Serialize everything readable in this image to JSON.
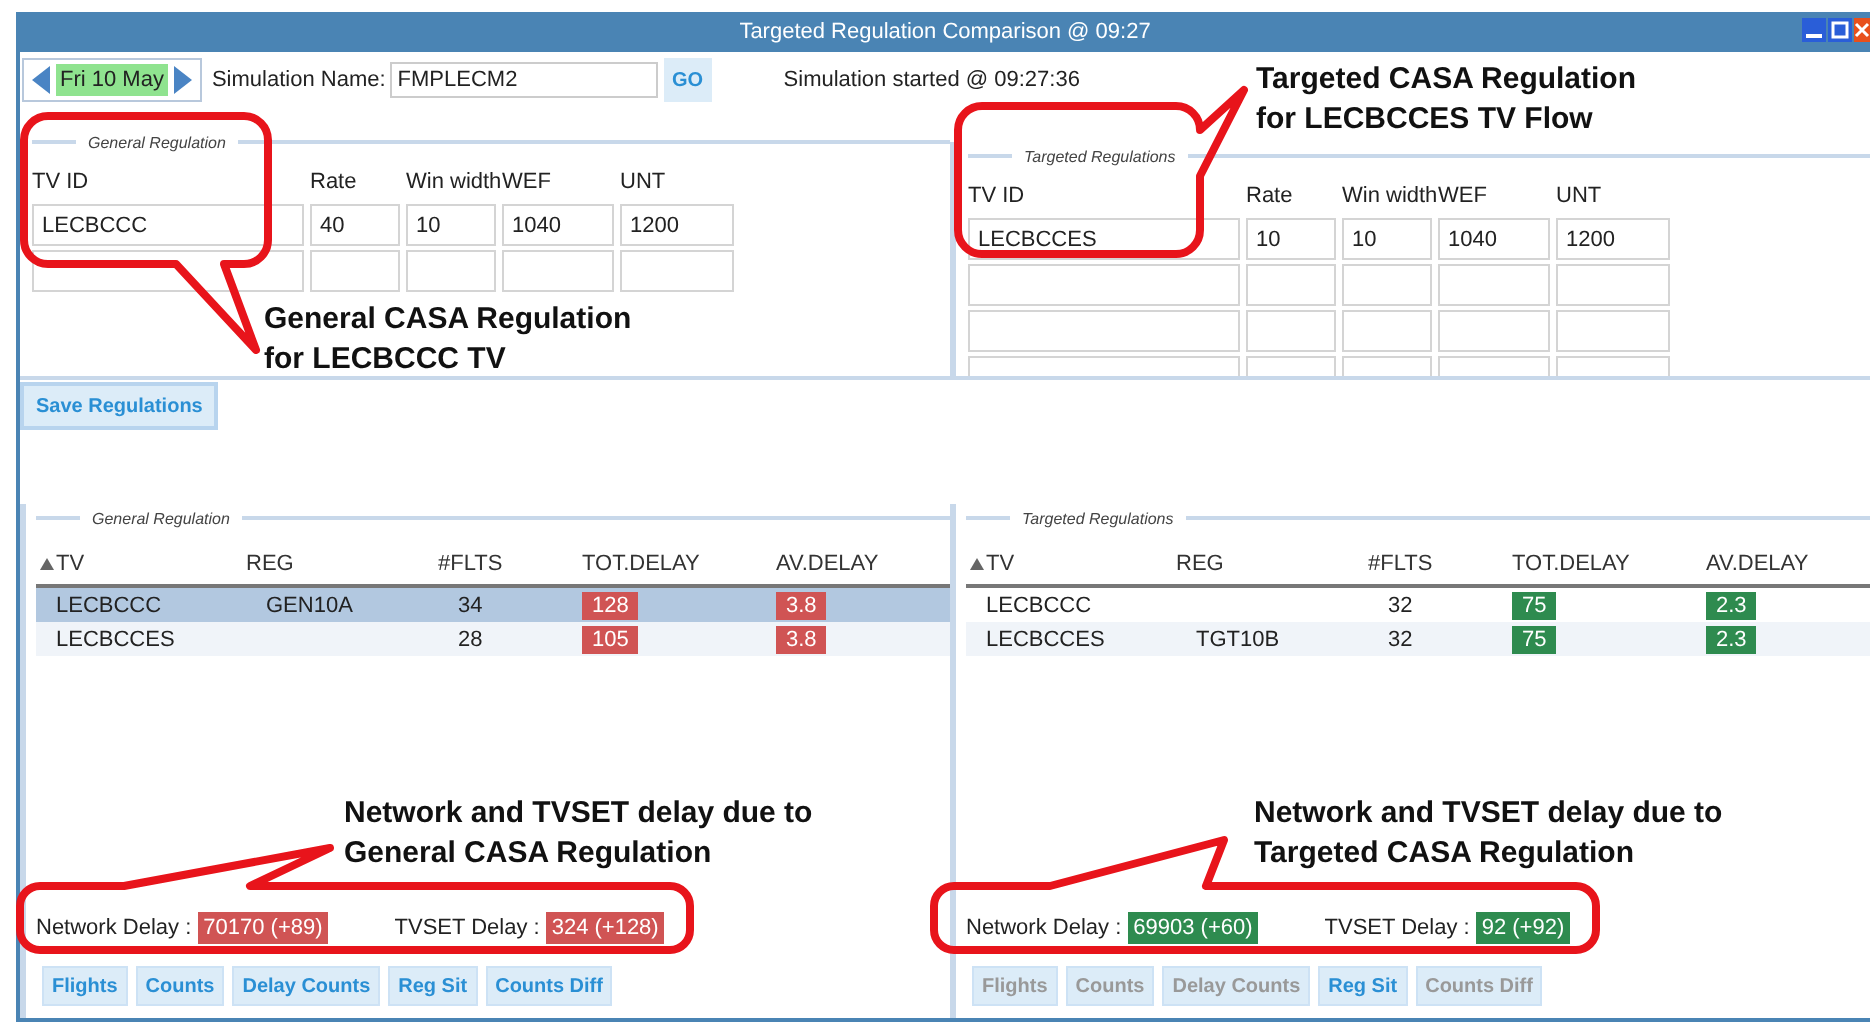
{
  "window": {
    "title": "Targeted Regulation Comparison @ 09:27"
  },
  "toolbar": {
    "date": "Fri 10 May",
    "simulation_name_label": "Simulation Name:",
    "simulation_name": "FMPLECM2",
    "go_button": "GO",
    "status": "Simulation started @ 09:27:36"
  },
  "regulation_panels": [
    {
      "legend": "General Regulation",
      "columns": [
        "TV ID",
        "Rate",
        "Win width",
        "WEF",
        "UNT"
      ],
      "rows": [
        {
          "kind": "filled",
          "values": [
            "LECBCCC",
            "40",
            "10",
            "1040",
            "1200"
          ]
        },
        {
          "kind": "blank"
        }
      ]
    },
    {
      "legend": "Targeted Regulations",
      "columns": [
        "TV ID",
        "Rate",
        "Win width",
        "WEF",
        "UNT"
      ],
      "rows": [
        {
          "kind": "filled",
          "values": [
            "LECBCCES",
            "10",
            "10",
            "1040",
            "1200"
          ]
        },
        {
          "kind": "blank"
        },
        {
          "kind": "blank"
        },
        {
          "kind": "blank"
        }
      ]
    }
  ],
  "save_button": "Save Regulations",
  "result_panels": [
    {
      "legend": "General Regulation",
      "columns": [
        "TV",
        "REG",
        "#FLTS",
        "TOT.DELAY",
        "AV.DELAY"
      ],
      "rows": [
        {
          "selected": true,
          "tv": "LECBCCC",
          "reg": "GEN10A",
          "flts": "34",
          "tot_delay": {
            "text": "128",
            "color": "#d05454"
          },
          "av_delay": {
            "text": "3.8",
            "color": "#d05454"
          }
        },
        {
          "selected": false,
          "tv": "LECBCCES",
          "flts": "28",
          "tot_delay": {
            "text": "105",
            "color": "#d05454"
          },
          "av_delay": {
            "text": "3.8",
            "color": "#d05454"
          }
        }
      ],
      "delays": [
        {
          "label": "Network Delay :",
          "value": "70170 (+89)",
          "color": "#d05454"
        },
        {
          "label": "TVSET Delay :",
          "value": "324 (+128)",
          "color": "#d05454"
        }
      ],
      "buttons": [
        {
          "label": "Flights",
          "disabled": false
        },
        {
          "label": "Counts",
          "disabled": false
        },
        {
          "label": "Delay Counts",
          "disabled": false
        },
        {
          "label": "Reg Sit",
          "disabled": false
        },
        {
          "label": "Counts Diff",
          "disabled": false
        }
      ]
    },
    {
      "legend": "Targeted Regulations",
      "columns": [
        "TV",
        "REG",
        "#FLTS",
        "TOT.DELAY",
        "AV.DELAY"
      ],
      "rows": [
        {
          "selected": false,
          "tv": "LECBCCC",
          "flts": "32",
          "tot_delay": {
            "text": "75",
            "color": "#2e8b4f"
          },
          "av_delay": {
            "text": "2.3",
            "color": "#2e8b4f"
          }
        },
        {
          "selected": false,
          "tv": "LECBCCES",
          "reg": "TGT10B",
          "flts": "32",
          "tot_delay": {
            "text": "75",
            "color": "#2e8b4f"
          },
          "av_delay": {
            "text": "2.3",
            "color": "#2e8b4f"
          }
        }
      ],
      "delays": [
        {
          "label": "Network Delay :",
          "value": "69903 (+60)",
          "color": "#2e8b4f"
        },
        {
          "label": "TVSET Delay :",
          "value": "92 (+92)",
          "color": "#2e8b4f"
        }
      ],
      "buttons": [
        {
          "label": "Flights",
          "disabled": true
        },
        {
          "label": "Counts",
          "disabled": true
        },
        {
          "label": "Delay Counts",
          "disabled": true
        },
        {
          "label": "Reg Sit",
          "disabled": false
        },
        {
          "label": "Counts Diff",
          "disabled": true
        }
      ]
    }
  ],
  "annotations": [
    {
      "lines": [
        "General CASA Regulation",
        "for LECBCCC TV"
      ]
    },
    {
      "lines": [
        "Targeted CASA Regulation",
        "for LECBCCES TV Flow"
      ]
    },
    {
      "lines": [
        "Network and TVSET delay due to",
        "General CASA Regulation"
      ]
    },
    {
      "lines": [
        "Network and TVSET delay due to",
        "Targeted CASA Regulation"
      ]
    }
  ]
}
